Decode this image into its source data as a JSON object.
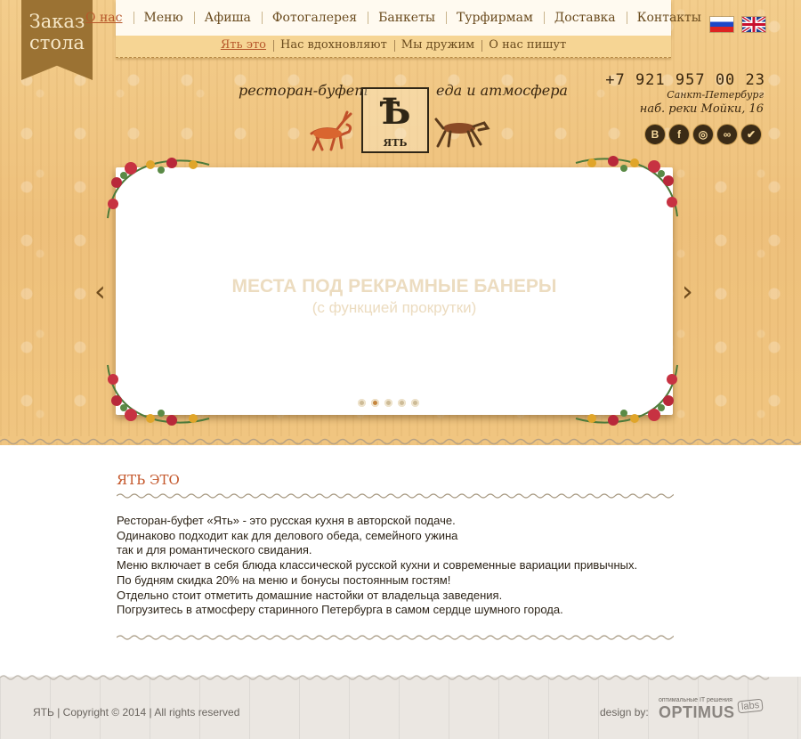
{
  "ribbon": {
    "line1": "Заказ",
    "line2": "стола"
  },
  "nav": {
    "items": [
      "О нас",
      "Меню",
      "Афиша",
      "Фотогалерея",
      "Банкеты",
      "Турфирмам",
      "Доставка",
      "Контакты"
    ],
    "active": "О нас"
  },
  "subnav": {
    "items": [
      "Ять это",
      "Нас вдохновляют",
      "Мы дружим",
      "О нас пишут"
    ],
    "active": "Ять это"
  },
  "languages": [
    "ru-flag",
    "en-flag"
  ],
  "logo": {
    "tagline_left": "ресторан-буфет",
    "tagline_right": "еда и атмосфера",
    "letter": "Ѣ",
    "name": "ЯТЬ"
  },
  "contacts": {
    "phone": "+7 921 957 00 23",
    "city": "Санкт-Петербург",
    "address": "наб. реки Мойки, 16"
  },
  "social": [
    {
      "icon": "vk-icon",
      "glyph": "В"
    },
    {
      "icon": "facebook-icon",
      "glyph": "f"
    },
    {
      "icon": "instagram-icon",
      "glyph": "◎"
    },
    {
      "icon": "tripadvisor-icon",
      "glyph": "∞"
    },
    {
      "icon": "foursquare-icon",
      "glyph": "✔"
    }
  ],
  "slider": {
    "line1": "МЕСТА ПОД РЕКРАМНЫЕ БАНЕРЫ",
    "line2": "(с функцией прокрутки)",
    "dots": 5,
    "active_dot": 1
  },
  "content": {
    "title": "ЯТЬ ЭТО",
    "paragraphs": [
      "Ресторан-буфет «Ять» - это русская кухня в авторской подаче.",
      "Одинаково подходит как для делового обеда, семейного ужина",
      "так и для романтического свидания.",
      "Меню включает в себя блюда классической русской кухни и современные вариации привычных.",
      "По будням скидка 20% на меню и бонусы постоянным гостям!",
      "Отдельно стоит отметить домашние настойки от владельца заведения.",
      "Погрузитесь в атмосферу старинного Петербурга в самом сердце шумного города."
    ]
  },
  "footer": {
    "copyright": "ЯТЬ  |  Copyright  ©  2014  |  All rights reserved",
    "design_by": "design by:",
    "optimus_tag": "оптимальные IT решения",
    "optimus": "OPTIMUS",
    "labs": "labs"
  },
  "colors": {
    "accent": "#c4572b",
    "wood": "#f0c580",
    "text": "#2d2418"
  }
}
